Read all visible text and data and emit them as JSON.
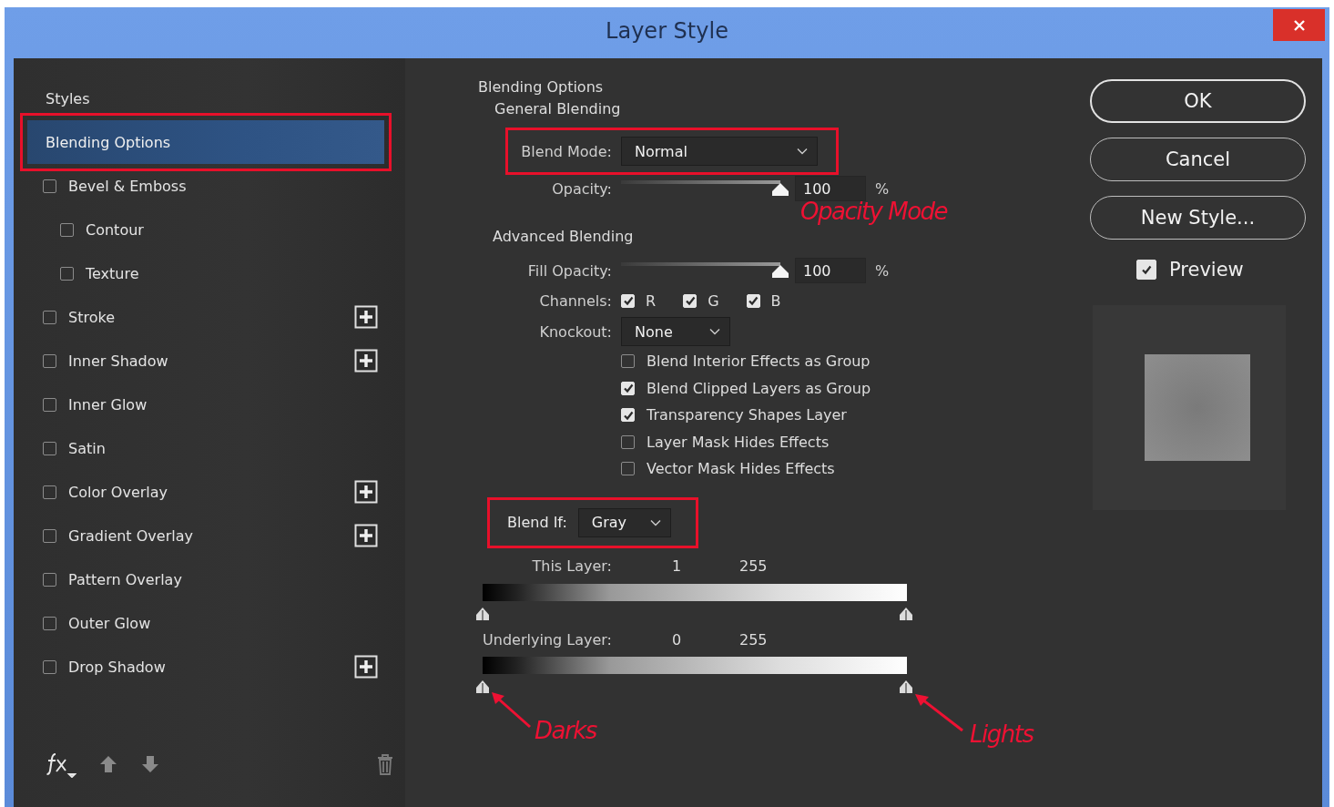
{
  "window": {
    "title": "Layer Style"
  },
  "styles_panel": {
    "items": [
      {
        "label": "Styles",
        "kind": "option",
        "selected": false
      },
      {
        "label": "Blending Options",
        "kind": "option",
        "selected": true,
        "annotated": true
      },
      {
        "label": "Bevel & Emboss",
        "kind": "effect",
        "selected": false,
        "checked": false,
        "children": [
          {
            "label": "Contour",
            "kind": "effect",
            "selected": false,
            "checked": false
          },
          {
            "label": "Texture",
            "kind": "effect",
            "selected": false,
            "checked": false
          }
        ]
      },
      {
        "label": "Stroke",
        "kind": "effect",
        "selected": false,
        "checked": false,
        "addable": true
      },
      {
        "label": "Inner Shadow",
        "kind": "effect",
        "selected": false,
        "checked": false,
        "addable": true
      },
      {
        "label": "Inner Glow",
        "kind": "effect",
        "selected": false,
        "checked": false
      },
      {
        "label": "Satin",
        "kind": "effect",
        "selected": false,
        "checked": false
      },
      {
        "label": "Color Overlay",
        "kind": "effect",
        "selected": false,
        "checked": false,
        "addable": true
      },
      {
        "label": "Gradient Overlay",
        "kind": "effect",
        "selected": false,
        "checked": false,
        "addable": true
      },
      {
        "label": "Pattern Overlay",
        "kind": "effect",
        "selected": false,
        "checked": false
      },
      {
        "label": "Outer Glow",
        "kind": "effect",
        "selected": false,
        "checked": false
      },
      {
        "label": "Drop Shadow",
        "kind": "effect",
        "selected": false,
        "checked": false,
        "addable": true
      }
    ]
  },
  "blending": {
    "title": "Blending Options",
    "general_title": "General Blending",
    "blend_mode": {
      "label": "Blend Mode:",
      "value": "Normal",
      "annotated": true
    },
    "opacity": {
      "label": "Opacity:",
      "level": 1,
      "value": "100",
      "unit": "%"
    },
    "advanced_title": "Advanced Blending",
    "fill_opacity": {
      "label": "Fill Opacity:",
      "level": 1,
      "value": "100",
      "unit": "%"
    },
    "channels": {
      "label": "Channels:",
      "items": [
        {
          "label": "R",
          "checked": true
        },
        {
          "label": "G",
          "checked": true
        },
        {
          "label": "B",
          "checked": true
        }
      ]
    },
    "knockout": {
      "label": "Knockout:",
      "value": "None"
    },
    "options": [
      {
        "label": "Blend Interior Effects as Group",
        "checked": false
      },
      {
        "label": "Blend Clipped Layers as Group",
        "checked": true
      },
      {
        "label": "Transparency Shapes Layer",
        "checked": true
      },
      {
        "label": "Layer Mask Hides Effects",
        "checked": false
      },
      {
        "label": "Vector Mask Hides Effects",
        "checked": false
      }
    ],
    "blend_if": {
      "label": "Blend If:",
      "value": "Gray",
      "annotated": true
    },
    "ranges": [
      {
        "label": "This Layer:",
        "low": "1",
        "high": "255"
      },
      {
        "label": "Underlying Layer:",
        "low": "0",
        "high": "255"
      }
    ]
  },
  "annotations": [
    {
      "kind": "note",
      "text": "Opacity Mode"
    },
    {
      "kind": "arrow",
      "text": "Darks"
    },
    {
      "kind": "arrow",
      "text": "Lights"
    }
  ],
  "buttons": [
    {
      "label": "OK",
      "default": true
    },
    {
      "label": "Cancel",
      "default": false
    },
    {
      "label": "New Style...",
      "default": false
    }
  ],
  "preview": {
    "label": "Preview",
    "checked": true
  }
}
